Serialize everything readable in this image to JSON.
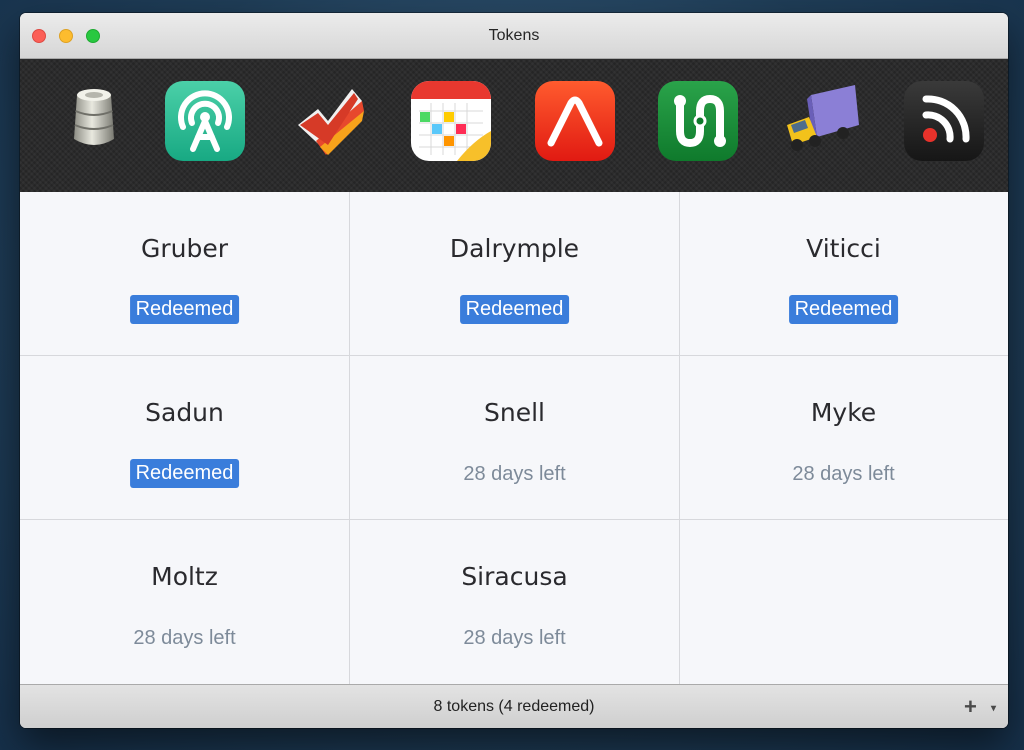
{
  "window": {
    "title": "Tokens"
  },
  "toolbar": {
    "apps": [
      {
        "icon": "database-cylinder-icon"
      },
      {
        "icon": "broadcast-tower-icon"
      },
      {
        "icon": "checkmark-icon"
      },
      {
        "icon": "calendar-icon"
      },
      {
        "icon": "arch-icon"
      },
      {
        "icon": "transit-route-icon"
      },
      {
        "icon": "delivery-truck-icon"
      },
      {
        "icon": "rss-feed-icon"
      }
    ],
    "selected_index": 1
  },
  "tokens": [
    {
      "name": "Gruber",
      "status": "Redeemed",
      "redeemed": true
    },
    {
      "name": "Dalrymple",
      "status": "Redeemed",
      "redeemed": true
    },
    {
      "name": "Viticci",
      "status": "Redeemed",
      "redeemed": true
    },
    {
      "name": "Sadun",
      "status": "Redeemed",
      "redeemed": true
    },
    {
      "name": "Snell",
      "status": "28 days left",
      "redeemed": false
    },
    {
      "name": "Myke",
      "status": "28 days left",
      "redeemed": false
    },
    {
      "name": "Moltz",
      "status": "28 days left",
      "redeemed": false
    },
    {
      "name": "Siracusa",
      "status": "28 days left",
      "redeemed": false
    }
  ],
  "statusbar": {
    "summary": "8 tokens (4 redeemed)",
    "add_label": "+"
  },
  "colors": {
    "badge": "#3a7ddb",
    "days_text": "#7d8a99"
  }
}
